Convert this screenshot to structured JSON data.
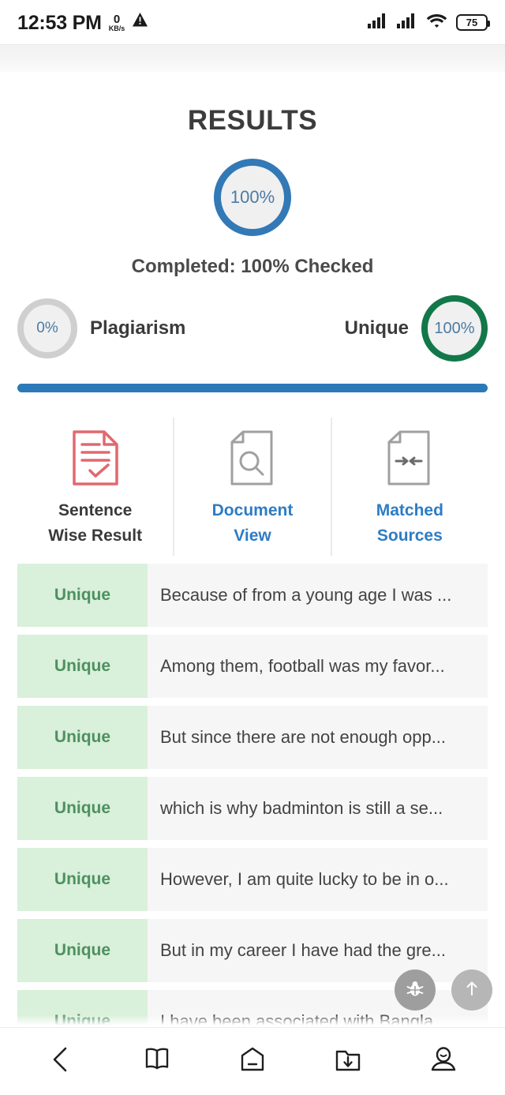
{
  "status_bar": {
    "time": "12:53 PM",
    "network_speed_value": "0",
    "network_speed_unit": "KB/s",
    "warning_icon": "warning-triangle-icon",
    "signal_icon_1": "signal-bars-icon",
    "signal_icon_2": "signal-bars-icon",
    "wifi_icon": "wifi-icon",
    "battery_level": "75"
  },
  "results": {
    "title": "RESULTS",
    "main_ring": {
      "value": "100%",
      "ring_color": "#3279b6",
      "fill_color": "#f0f0f0",
      "text_color": "#4c7ba3"
    },
    "completed_text": "Completed: 100% Checked",
    "plagiarism": {
      "value": "0%",
      "label": "Plagiarism",
      "ring_color": "#cfcfcf"
    },
    "unique": {
      "value": "100%",
      "label": "Unique",
      "ring_color": "#12784a"
    },
    "progress": {
      "percent": 100,
      "bar_color": "#2b79b8"
    }
  },
  "tabs": [
    {
      "label_line1": "Sentence",
      "label_line2": "Wise Result",
      "icon": "document-check-icon",
      "icon_color": "#e2686f",
      "active": true
    },
    {
      "label_line1": "Document",
      "label_line2": "View",
      "icon": "document-search-icon",
      "icon_color": "#a0a0a0",
      "active": false
    },
    {
      "label_line1": "Matched",
      "label_line2": "Sources",
      "icon": "document-arrows-icon",
      "icon_color": "#a0a0a0",
      "active": false
    }
  ],
  "sentence_rows": [
    {
      "tag": "Unique",
      "text": "Because of from a young age I was ..."
    },
    {
      "tag": "Unique",
      "text": "Among them, football was my favor..."
    },
    {
      "tag": "Unique",
      "text": "But since there are not enough opp..."
    },
    {
      "tag": "Unique",
      "text": "which is why badminton is still a se..."
    },
    {
      "tag": "Unique",
      "text": "However, I am quite lucky to be in o..."
    },
    {
      "tag": "Unique",
      "text": "But in my career I have had the gre..."
    },
    {
      "tag": "Unique",
      "text": "I have been associated with Bangla..."
    }
  ],
  "floating_buttons": [
    {
      "name": "bug-report-button",
      "icon": "bug-icon"
    },
    {
      "name": "scroll-to-top-button",
      "icon": "arrow-up-icon"
    }
  ],
  "bottom_nav": [
    {
      "name": "back-button",
      "icon": "chevron-left-icon"
    },
    {
      "name": "bookmarks-button",
      "icon": "book-icon"
    },
    {
      "name": "home-button",
      "icon": "home-icon"
    },
    {
      "name": "downloads-button",
      "icon": "folder-download-icon"
    },
    {
      "name": "profile-button",
      "icon": "person-icon"
    }
  ]
}
